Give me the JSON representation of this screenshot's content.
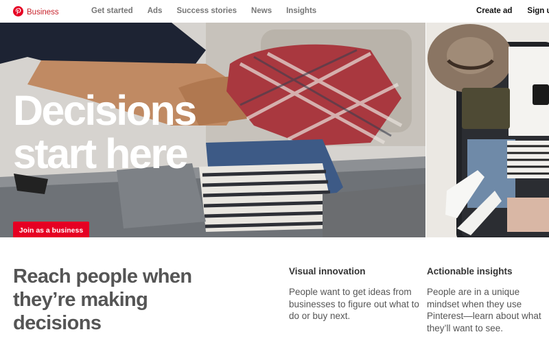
{
  "nav": {
    "brand_label": "Business",
    "links": [
      "Get started",
      "Ads",
      "Success stories",
      "News",
      "Insights"
    ],
    "create_ad": "Create ad",
    "sign_up": "Sign up"
  },
  "hero": {
    "title_line1": "Decisions",
    "title_line2": "start here",
    "cta_label": "Join as a business"
  },
  "section": {
    "title": "Reach people when they’re making decisions",
    "features": [
      {
        "title": "Visual innovation",
        "text": "People want to get ideas from businesses to figure out what to do or buy next."
      },
      {
        "title": "Actionable insights",
        "text": "People are in a unique mindset when they use Pinterest—learn about what they’ll want to see."
      }
    ]
  },
  "colors": {
    "brand_red": "#e60023",
    "brand_text_red": "#c8232c"
  },
  "icons": {
    "brand": "pinterest-logo-icon"
  }
}
